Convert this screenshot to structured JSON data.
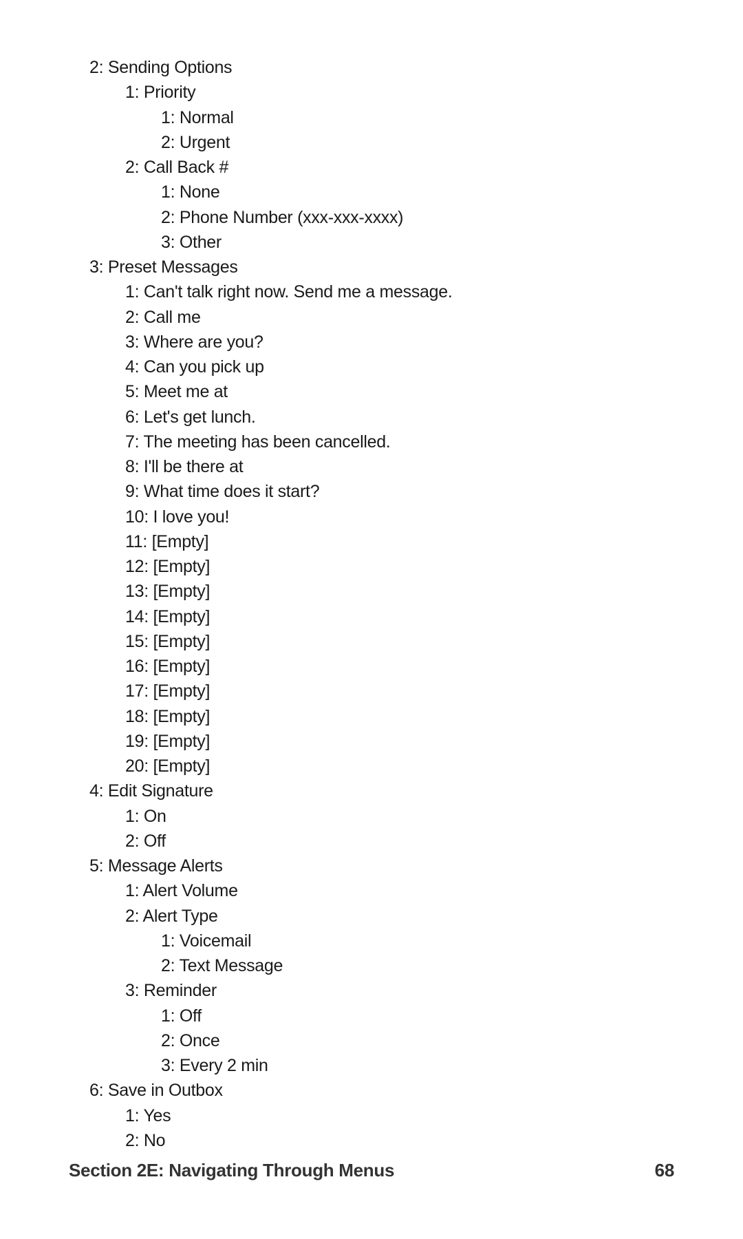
{
  "sep": ": ",
  "empty_label": "[Empty]",
  "menu": {
    "l2": {
      "n": "2",
      "t": "Sending Options",
      "children": {
        "l2_1": {
          "n": "1",
          "t": "Priority",
          "children": {
            "l2_1_1": {
              "n": "1",
              "t": "Normal"
            },
            "l2_1_2": {
              "n": "2",
              "t": "Urgent"
            }
          }
        },
        "l2_2": {
          "n": "2",
          "t": "Call Back #",
          "children": {
            "l2_2_1": {
              "n": "1",
              "t": "None"
            },
            "l2_2_2": {
              "n": "2",
              "t": "Phone Number (xxx-xxx-xxxx)"
            },
            "l2_2_3": {
              "n": "3",
              "t": "Other"
            }
          }
        }
      }
    },
    "l3": {
      "n": "3",
      "t": "Preset Messages",
      "children": {
        "p1": {
          "n": "1",
          "t": "Can't talk right now. Send me a message."
        },
        "p2": {
          "n": "2",
          "t": "Call me"
        },
        "p3": {
          "n": "3",
          "t": "Where are you?"
        },
        "p4": {
          "n": "4",
          "t": "Can you pick up"
        },
        "p5": {
          "n": "5",
          "t": "Meet me at"
        },
        "p6": {
          "n": "6",
          "t": "Let's get lunch."
        },
        "p7": {
          "n": "7",
          "t": "The meeting has been cancelled."
        },
        "p8": {
          "n": "8",
          "t": "I'll be there at"
        },
        "p9": {
          "n": "9",
          "t": "What time does it start?"
        },
        "p10": {
          "n": "10",
          "t": "I love you!"
        },
        "p11": {
          "n": "11",
          "t": "[Empty]"
        },
        "p12": {
          "n": "12",
          "t": "[Empty]"
        },
        "p13": {
          "n": "13",
          "t": "[Empty]"
        },
        "p14": {
          "n": "14",
          "t": "[Empty]"
        },
        "p15": {
          "n": "15",
          "t": "[Empty]"
        },
        "p16": {
          "n": "16",
          "t": "[Empty]"
        },
        "p17": {
          "n": "17",
          "t": "[Empty]"
        },
        "p18": {
          "n": "18",
          "t": "[Empty]"
        },
        "p19": {
          "n": "19",
          "t": "[Empty]"
        },
        "p20": {
          "n": "20",
          "t": "[Empty]"
        }
      }
    },
    "l4": {
      "n": "4",
      "t": "Edit Signature",
      "children": {
        "l4_1": {
          "n": "1",
          "t": "On"
        },
        "l4_2": {
          "n": "2",
          "t": "Off"
        }
      }
    },
    "l5": {
      "n": "5",
      "t": "Message Alerts",
      "children": {
        "l5_1": {
          "n": "1",
          "t": "Alert Volume"
        },
        "l5_2": {
          "n": "2",
          "t": "Alert Type",
          "children": {
            "l5_2_1": {
              "n": "1",
              "t": "Voicemail"
            },
            "l5_2_2": {
              "n": "2",
              "t": "Text Message"
            }
          }
        },
        "l5_3": {
          "n": "3",
          "t": "Reminder",
          "children": {
            "l5_3_1": {
              "n": "1",
              "t": "Off"
            },
            "l5_3_2": {
              "n": "2",
              "t": "Once"
            },
            "l5_3_3": {
              "n": "3",
              "t": "Every 2 min"
            }
          }
        }
      }
    },
    "l6": {
      "n": "6",
      "t": "Save in Outbox",
      "children": {
        "l6_1": {
          "n": "1",
          "t": "Yes"
        },
        "l6_2": {
          "n": "2",
          "t": "No"
        }
      }
    }
  },
  "footer": {
    "section": "Section 2E: Navigating Through Menus",
    "page": "68"
  }
}
